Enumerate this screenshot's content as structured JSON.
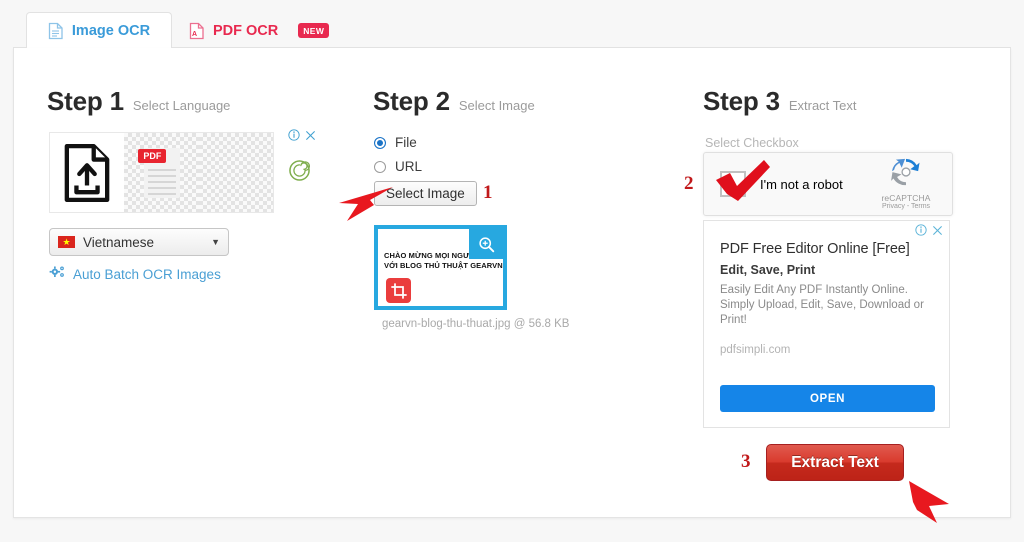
{
  "tabs": [
    {
      "label": "Image OCR",
      "icon": "document-icon",
      "active": true,
      "badge": ""
    },
    {
      "label": "PDF OCR",
      "icon": "pdf-icon",
      "active": false,
      "badge": "NEW"
    }
  ],
  "steps": {
    "one": {
      "number": "Step 1",
      "subtitle": "Select Language"
    },
    "two": {
      "number": "Step 2",
      "subtitle": "Select Image"
    },
    "three": {
      "number": "Step 3",
      "subtitle": "Extract Text"
    }
  },
  "step1": {
    "banner_ad": {
      "pdf_label": "PDF",
      "info_icon": "info-icon",
      "close_icon": "close-icon",
      "advertiser_icon": "spiral-icon"
    },
    "language_select": {
      "value": "Vietnamese",
      "flag": "vietnam-flag",
      "caret": "▼"
    },
    "batch_link": {
      "label": "Auto Batch OCR Images",
      "icon": "gears-icon"
    }
  },
  "step2": {
    "source_options": [
      {
        "label": "File",
        "selected": true
      },
      {
        "label": "URL",
        "selected": false
      }
    ],
    "select_image_button": "Select Image",
    "marker_1": "1",
    "thumbnail": {
      "overlay_text": "CHÀO MỪNG MỌI NGƯỜI ĐẾN VỚI BLOG THỦ THUẬT GEARVN",
      "zoom_icon": "magnifier-plus-icon",
      "crop_icon": "crop-icon"
    },
    "file_meta": "gearvn-blog-thu-thuat.jpg @ 56.8 KB"
  },
  "step3": {
    "checkbox_hint": "Select Checkbox",
    "marker_2": "2",
    "recaptcha": {
      "label": "I'm not a robot",
      "brand": "reCAPTCHA",
      "privacy_terms": "Privacy - Terms",
      "logo_icon": "recaptcha-logo-icon",
      "checkmark_icon": "red-checkmark-icon"
    },
    "ad": {
      "info_icon": "info-icon",
      "close_icon": "close-icon",
      "title": "PDF Free Editor Online [Free]",
      "subtitle": "Edit, Save, Print",
      "description": "Easily Edit Any PDF Instantly Online. Simply Upload, Edit, Save, Download or Print!",
      "domain": "pdfsimpli.com",
      "cta": "OPEN"
    },
    "marker_3": "3",
    "extract_button": "Extract Text"
  },
  "colors": {
    "tab_active": "#3a9bd9",
    "tab_inactive": "#e8294f",
    "accent_blue": "#27a8e0",
    "ad_blue": "#1585e8",
    "extract_red": "#d93b2e",
    "marker_red": "#c1191b",
    "page_bg": "#f7f7f7"
  }
}
